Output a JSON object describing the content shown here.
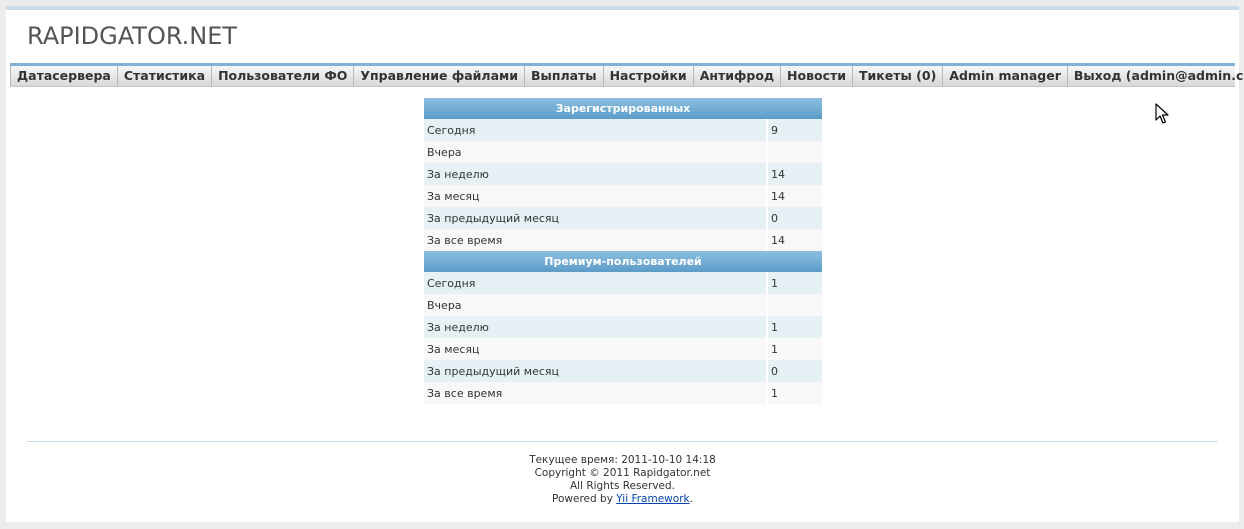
{
  "header": {
    "logo": "RAPIDGATOR.NET"
  },
  "nav": {
    "items": [
      "Датасервера",
      "Статистика",
      "Пользователи ФО",
      "Управление файлами",
      "Выплаты",
      "Настройки",
      "Антифрод",
      "Новости",
      "Тикеты (0)",
      "Admin manager",
      "Выход (admin@admin.com)"
    ]
  },
  "stats": {
    "registered": {
      "title": "Зарегистрированных",
      "rows": [
        {
          "label": "Сегодня",
          "value": "9"
        },
        {
          "label": "Вчера",
          "value": ""
        },
        {
          "label": "За неделю",
          "value": "14"
        },
        {
          "label": "За месяц",
          "value": "14"
        },
        {
          "label": "За предыдущий месяц",
          "value": "0"
        },
        {
          "label": "За все время",
          "value": "14"
        }
      ]
    },
    "premium": {
      "title": "Премиум-пользователей",
      "rows": [
        {
          "label": "Сегодня",
          "value": "1"
        },
        {
          "label": "Вчера",
          "value": ""
        },
        {
          "label": "За неделю",
          "value": "1"
        },
        {
          "label": "За месяц",
          "value": "1"
        },
        {
          "label": "За предыдущий месяц",
          "value": "0"
        },
        {
          "label": "За все время",
          "value": "1"
        }
      ]
    }
  },
  "footer": {
    "current_time": "Текущее время: 2011-10-10 14:18",
    "copyright": "Copyright © 2011 Rapidgator.net",
    "rights": "All Rights Reserved.",
    "powered_prefix": "Powered by ",
    "powered_link": "Yii Framework",
    "powered_suffix": "."
  },
  "colors": {
    "accent": "#5d9cc8",
    "row_odd": "#e5f1f4",
    "row_even": "#f8f8f8",
    "link": "#0645ad"
  }
}
